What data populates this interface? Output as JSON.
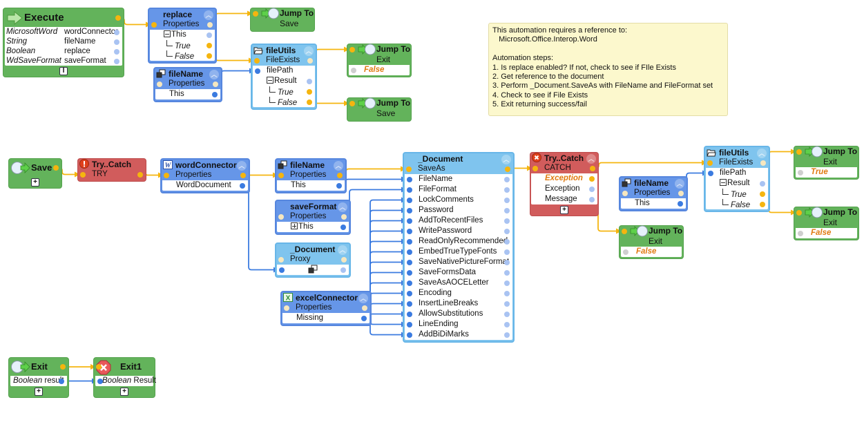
{
  "colors": {
    "flow_wire": "#f5b50f",
    "data_wire": "#3b7be0",
    "event_node": "#63b35b",
    "object_node": "#6696e8",
    "component_node": "#7fc4ee",
    "try_node": "#d15c5c",
    "note_background": "#fcf8cd"
  },
  "nodes": {
    "execute": {
      "title": "Execute",
      "icon": "execute-arrow-icon",
      "rows": [
        {
          "type": "MicrosoftWord",
          "name": "wordConnector"
        },
        {
          "type": "String",
          "name": "fileName"
        },
        {
          "type": "Boolean",
          "name": "replace"
        },
        {
          "type": "WdSaveFormat",
          "name": "saveFormat"
        }
      ]
    },
    "replace": {
      "title": "replace",
      "head": [
        "Properties"
      ],
      "rows": [
        "This",
        "True",
        "False"
      ]
    },
    "jump_save_1": {
      "title": "Jump To",
      "icon": "jump-icon",
      "head": [
        "Save"
      ]
    },
    "fileutils_1": {
      "title": "fileUtils",
      "icon": "folder-icon",
      "head": [
        "FileExists"
      ],
      "rows": [
        "filePath",
        "Result",
        "True",
        "False"
      ]
    },
    "filename_1": {
      "title": "fileName",
      "icon": "variable-icon",
      "head": [
        "Properties"
      ],
      "rows": [
        "This"
      ]
    },
    "jump_exit_1": {
      "title": "Jump To",
      "icon": "jump-icon",
      "head": [
        "Exit"
      ],
      "rows": [
        "False"
      ]
    },
    "jump_save_2": {
      "title": "Jump To",
      "icon": "jump-icon",
      "head": [
        "Save"
      ]
    },
    "save": {
      "title": "Save",
      "icon": "jump-target-icon"
    },
    "try_1": {
      "title": "Try..Catch",
      "icon": "warning-icon",
      "head": [
        "TRY"
      ]
    },
    "word_connector": {
      "title": "wordConnector",
      "icon": "word-icon",
      "head": [
        "Properties"
      ],
      "rows": [
        "WordDocument"
      ]
    },
    "filename_2": {
      "title": "fileName",
      "icon": "variable-icon",
      "head": [
        "Properties"
      ],
      "rows": [
        "This"
      ]
    },
    "save_format": {
      "title": "saveFormat",
      "head": [
        "Properties"
      ],
      "rows": [
        "This"
      ]
    },
    "document_proxy": {
      "title": "_Document",
      "head": [
        "Proxy"
      ],
      "rows": [
        ""
      ]
    },
    "excel_connector": {
      "title": "excelConnector",
      "icon": "excel-icon",
      "head": [
        "Properties"
      ],
      "rows": [
        "Missing"
      ]
    },
    "document": {
      "title": "_Document",
      "head": [
        "SaveAs"
      ],
      "rows": [
        "FileName",
        "FileFormat",
        "LockComments",
        "Password",
        "AddToRecentFiles",
        "WritePassword",
        "ReadOnlyRecommended",
        "EmbedTrueTypeFonts",
        "SaveNativePictureFormat",
        "SaveFormsData",
        "SaveAsAOCELetter",
        "Encoding",
        "InsertLineBreaks",
        "AllowSubstitutions",
        "LineEnding",
        "AddBiDiMarks"
      ]
    },
    "try_2": {
      "title": "Try..Catch",
      "icon": "error-icon",
      "head": [
        "CATCH"
      ],
      "rows": [
        "Exception",
        "Exception",
        "Message"
      ]
    },
    "filename_3": {
      "title": "fileName",
      "icon": "variable-icon",
      "head": [
        "Properties"
      ],
      "rows": [
        "This"
      ]
    },
    "fileutils_2": {
      "title": "fileUtils",
      "icon": "folder-icon",
      "head": [
        "FileExists"
      ],
      "rows": [
        "filePath",
        "Result",
        "True",
        "False"
      ]
    },
    "jump_exit_true": {
      "title": "Jump To",
      "icon": "jump-icon",
      "head": [
        "Exit"
      ],
      "rows": [
        "True"
      ]
    },
    "jump_exit_false": {
      "title": "Jump To",
      "icon": "jump-icon",
      "head": [
        "Exit"
      ],
      "rows": [
        "False"
      ]
    },
    "jump_exit_false_2": {
      "title": "Jump To",
      "icon": "jump-icon",
      "head": [
        "Exit"
      ],
      "rows": [
        "False"
      ]
    },
    "exit": {
      "title": "Exit",
      "icon": "jump-target-icon",
      "rows": [
        {
          "type": "Boolean",
          "name": "result"
        }
      ]
    },
    "exit1": {
      "title": "Exit1",
      "icon": "stop-icon",
      "rows": [
        {
          "type": "Boolean",
          "name": "Result"
        }
      ]
    }
  },
  "note": {
    "lines": [
      "This automation requires a reference to:",
      "   Microsoft.Office.Interop.Word",
      "",
      "Automation steps:",
      "1. Is replace enabled? If not, check to see if FIle Exists",
      "2. Get reference to the document",
      "3. Perform _Document.SaveAs with FileName and FileFormat set",
      "4. Check to see if File Exists",
      "5. Exit returning success/fail"
    ]
  }
}
